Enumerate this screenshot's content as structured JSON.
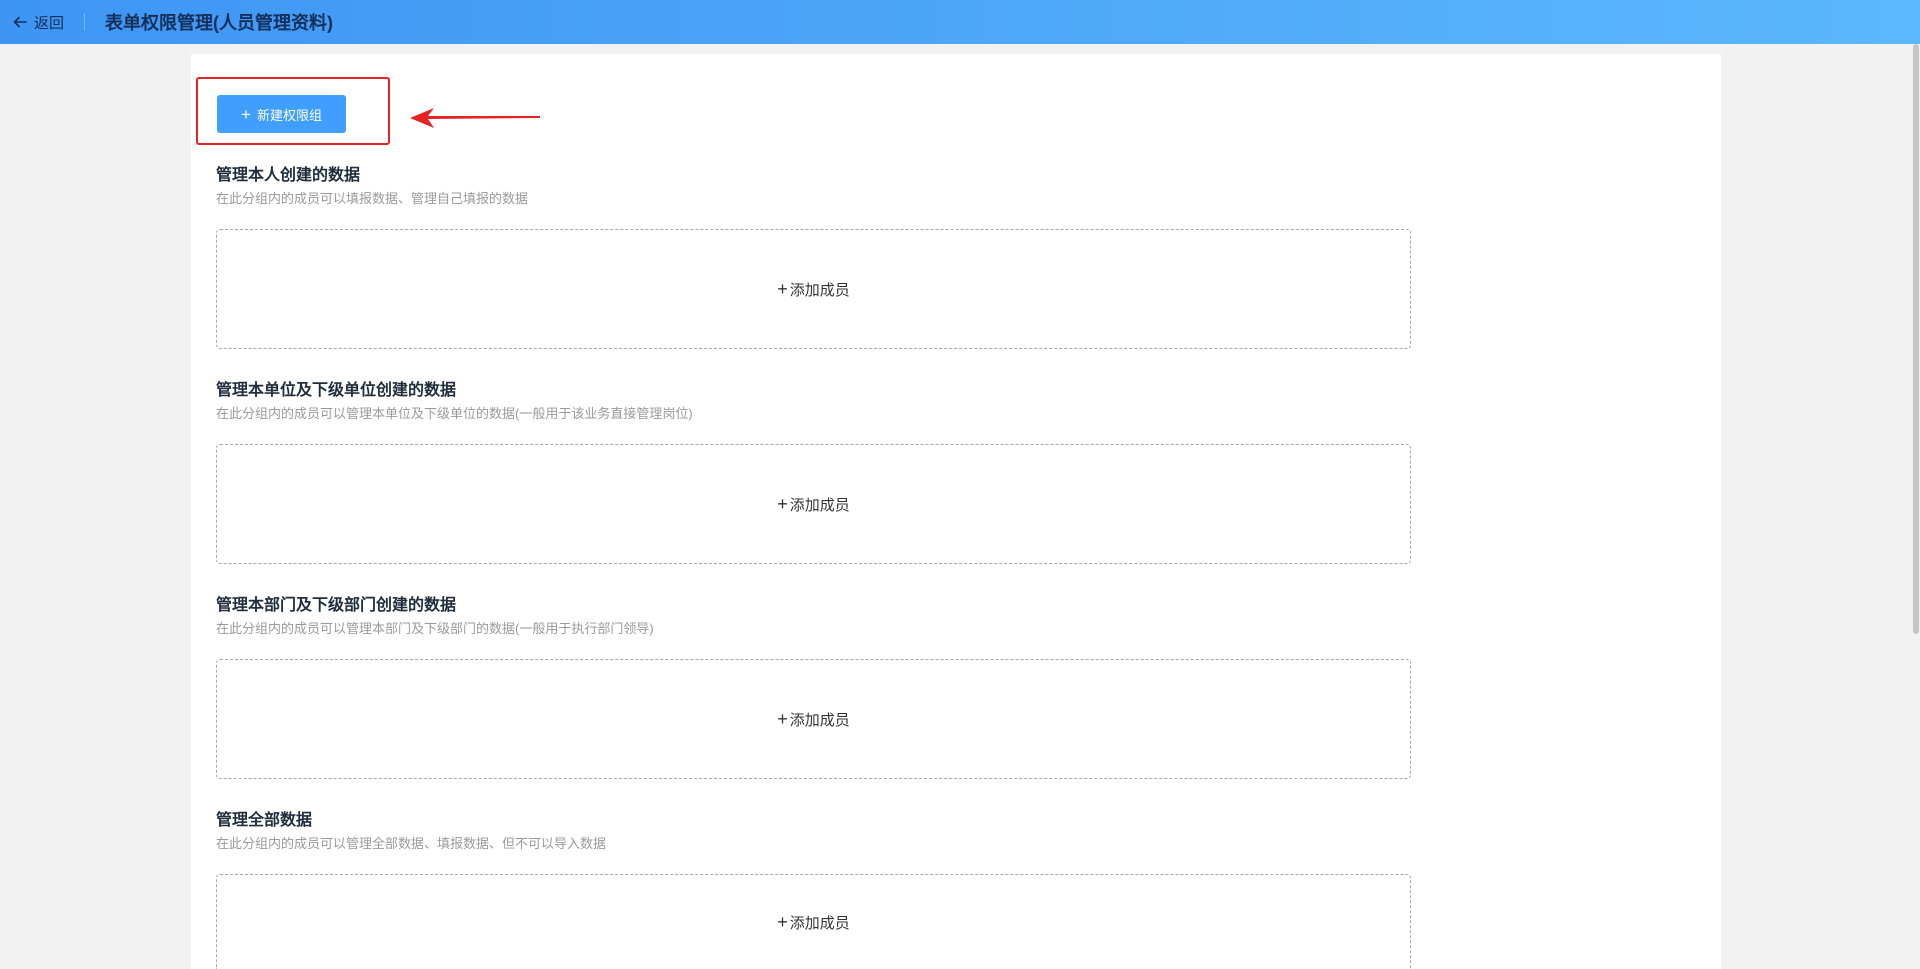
{
  "header": {
    "back_label": "返回",
    "title": "表单权限管理(人员管理资料)"
  },
  "toolbar": {
    "new_group_label": "新建权限组"
  },
  "sections": [
    {
      "title": "管理本人创建的数据",
      "description": "在此分组内的成员可以填报数据、管理自己填报的数据",
      "add_label": "添加成员"
    },
    {
      "title": "管理本单位及下级单位创建的数据",
      "description": "在此分组内的成员可以管理本单位及下级单位的数据(一般用于该业务直接管理岗位)",
      "add_label": "添加成员"
    },
    {
      "title": "管理本部门及下级部门创建的数据",
      "description": "在此分组内的成员可以管理本部门及下级部门的数据(一般用于执行部门领导)",
      "add_label": "添加成员"
    },
    {
      "title": "管理全部数据",
      "description": "在此分组内的成员可以管理全部数据、填报数据、但不可以导入数据",
      "add_label": "添加成员"
    }
  ],
  "colors": {
    "header_start": "#3e95f4",
    "header_end": "#5cb8fd",
    "primary_button": "#409eff",
    "annotation_red": "#e52323"
  },
  "icons": {
    "back": "arrow-left-icon",
    "plus": "plus-icon",
    "annotation": "red-arrow-icon"
  }
}
